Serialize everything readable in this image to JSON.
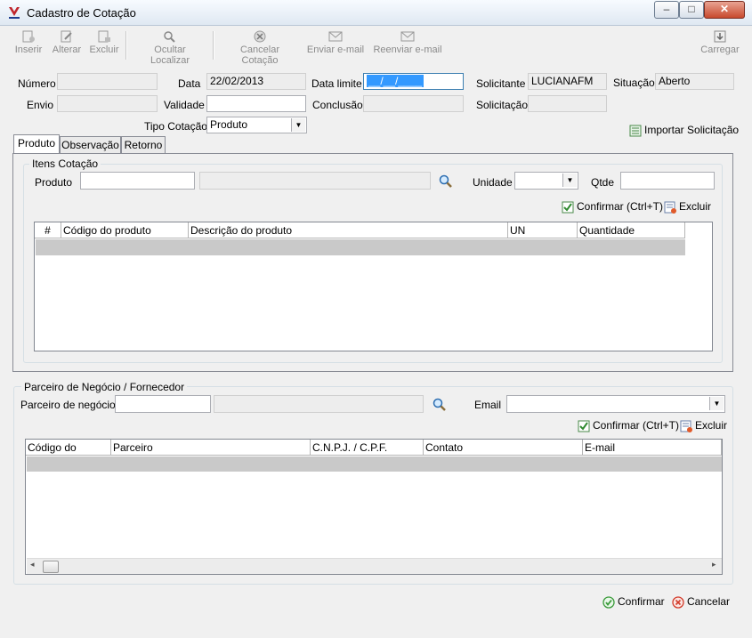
{
  "window": {
    "title": "Cadastro de Cotação",
    "min": "–",
    "max": "□",
    "close": "✕"
  },
  "toolbar": {
    "inserir": "Inserir",
    "alterar": "Alterar",
    "excluir": "Excluir",
    "ocultar_localizar": "Ocultar Localizar",
    "cancelar_cotacao": "Cancelar Cotação",
    "enviar_email": "Enviar e-mail",
    "reenviar_email": "Reenviar e-mail",
    "carregar": "Carregar"
  },
  "form": {
    "numero_label": "Número",
    "numero_value": "",
    "data_label": "Data",
    "data_value": "22/02/2013",
    "data_limite_label": "Data limite",
    "data_limite_value": "__/__/____",
    "solicitante_label": "Solicitante",
    "solicitante_value": "LUCIANAFM",
    "situacao_label": "Situação",
    "situacao_value": "Aberto",
    "envio_label": "Envio",
    "envio_value": "",
    "validade_label": "Validade",
    "validade_value": "",
    "conclusao_label": "Conclusão",
    "conclusao_value": "",
    "solicitacao_label": "Solicitação",
    "solicitacao_value": "",
    "tipo_cotacao_label": "Tipo Cotação",
    "tipo_cotacao_value": "Produto",
    "importar_solicitacao": "Importar Solicitação"
  },
  "tabs": [
    "Produto",
    "Observação",
    "Retorno"
  ],
  "itens": {
    "group_title": "Itens Cotação",
    "produto_label": "Produto",
    "produto_code": "",
    "produto_desc": "",
    "unidade_label": "Unidade",
    "unidade_value": "",
    "qtde_label": "Qtde",
    "qtde_value": "",
    "confirmar": "Confirmar (Ctrl+T)",
    "excluir": "Excluir",
    "columns": [
      "#",
      "Código do produto",
      "Descrição do produto",
      "UN",
      "Quantidade"
    ]
  },
  "parceiro": {
    "group_title": "Parceiro de Negócio / Fornecedor",
    "parceiro_label": "Parceiro de negócios",
    "parceiro_code": "",
    "parceiro_name": "",
    "email_label": "Email",
    "email_value": "",
    "confirmar": "Confirmar (Ctrl+T)",
    "excluir": "Excluir",
    "columns": [
      "Código do parceiro",
      "Parceiro",
      "C.N.P.J. / C.P.F.",
      "Contato",
      "E-mail"
    ]
  },
  "footer": {
    "confirmar": "Confirmar",
    "cancelar": "Cancelar"
  },
  "colors": {
    "accent_green": "#3a9a3a",
    "accent_red": "#d23b2a",
    "selection": "#3399ff"
  }
}
